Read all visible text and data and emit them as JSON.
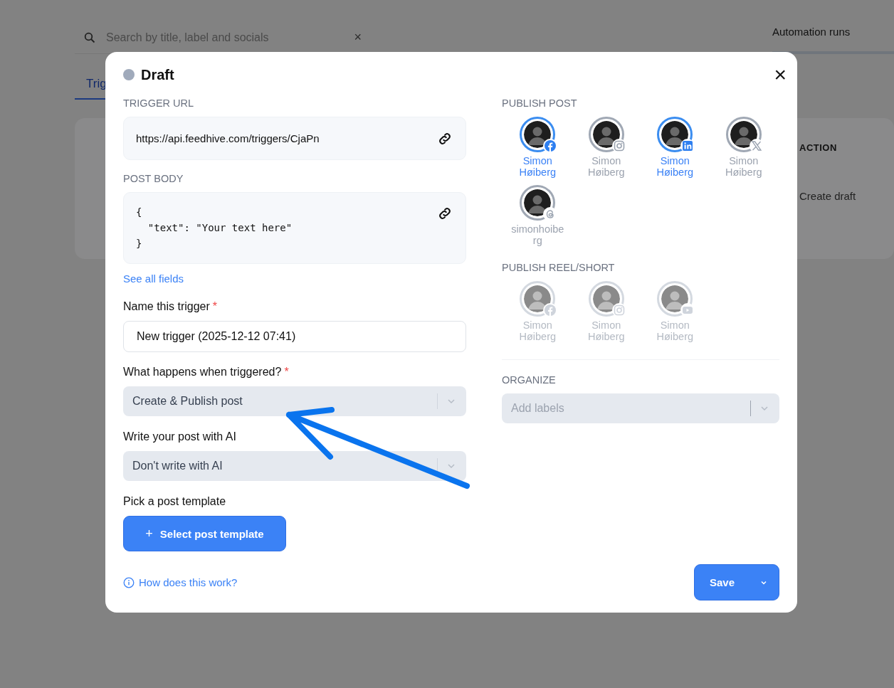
{
  "background": {
    "search": {
      "placeholder": "Search by title, label and socials",
      "clear": "×"
    },
    "tab": "Trig",
    "automation_runs": "Automation runs",
    "table": {
      "column_header": "ACTION",
      "cell": "Create draft"
    }
  },
  "dialog": {
    "status": "Draft",
    "close": "×",
    "trigger_url": {
      "label": "TRIGGER URL",
      "value": "https://api.feedhive.com/triggers/CjaPn"
    },
    "post_body": {
      "label": "POST BODY",
      "lines": [
        "{",
        "  \"text\": \"Your text here\"",
        "}"
      ]
    },
    "see_all_fields": "See all fields",
    "name_field": {
      "label": "Name this trigger",
      "required_mark": "*",
      "value": "New trigger (2025-12-12 07:41)"
    },
    "action_select": {
      "label": "What happens when triggered?",
      "required_mark": "*",
      "value": "Create & Publish post"
    },
    "ai_select": {
      "label": "Write your post with AI",
      "value": "Don't write with AI"
    },
    "template": {
      "label": "Pick a post template",
      "button": "Select post template",
      "plus": "+"
    },
    "help_link": "How does this work?",
    "publish_post": {
      "label": "PUBLISH POST",
      "accounts": [
        {
          "name": "Simon Høiberg",
          "kind": "facebook",
          "selected": true,
          "disabled": false
        },
        {
          "name": "Simon Høiberg",
          "kind": "instagram",
          "selected": false,
          "disabled": false
        },
        {
          "name": "Simon Høiberg",
          "kind": "linkedin",
          "selected": true,
          "disabled": false
        },
        {
          "name": "Simon Høiberg",
          "kind": "x",
          "selected": false,
          "disabled": false
        },
        {
          "name": "simonhoiberg",
          "kind": "threads",
          "selected": false,
          "disabled": false
        }
      ]
    },
    "publish_reel": {
      "label": "PUBLISH REEL/SHORT",
      "accounts": [
        {
          "name": "Simon Høiberg",
          "kind": "facebook",
          "disabled": true
        },
        {
          "name": "Simon Høiberg",
          "kind": "instagram",
          "disabled": true
        },
        {
          "name": "Simon Høiberg",
          "kind": "youtube",
          "disabled": true
        }
      ]
    },
    "organize": {
      "label": "ORGANIZE",
      "placeholder": "Add labels"
    },
    "save": "Save"
  }
}
